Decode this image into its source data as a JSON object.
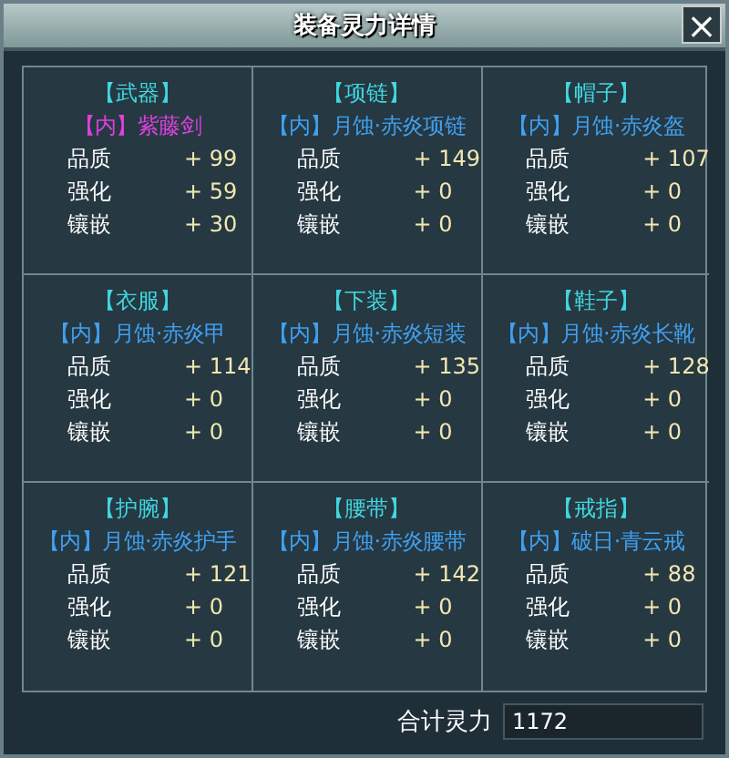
{
  "window": {
    "title": "装备灵力详情",
    "close": "×"
  },
  "slots": [
    {
      "slot": "【武器】",
      "item": "【内】紫藤剑",
      "color": "#e040e0",
      "stats": [
        {
          "label": "品质",
          "value": "+ 99"
        },
        {
          "label": "强化",
          "value": "+ 59"
        },
        {
          "label": "镶嵌",
          "value": "+ 30"
        }
      ]
    },
    {
      "slot": "【项链】",
      "item": "【内】月蚀·赤炎项链",
      "color": "#40a0f0",
      "stats": [
        {
          "label": "品质",
          "value": "+ 149"
        },
        {
          "label": "强化",
          "value": "+ 0"
        },
        {
          "label": "镶嵌",
          "value": "+ 0"
        }
      ]
    },
    {
      "slot": "【帽子】",
      "item": "【内】月蚀·赤炎盔",
      "color": "#40a0f0",
      "stats": [
        {
          "label": "品质",
          "value": "+ 107"
        },
        {
          "label": "强化",
          "value": "+ 0"
        },
        {
          "label": "镶嵌",
          "value": "+ 0"
        }
      ]
    },
    {
      "slot": "【衣服】",
      "item": "【内】月蚀·赤炎甲",
      "color": "#40a0f0",
      "stats": [
        {
          "label": "品质",
          "value": "+ 114"
        },
        {
          "label": "强化",
          "value": "+ 0"
        },
        {
          "label": "镶嵌",
          "value": "+ 0"
        }
      ]
    },
    {
      "slot": "【下装】",
      "item": "【内】月蚀·赤炎短装",
      "color": "#40a0f0",
      "stats": [
        {
          "label": "品质",
          "value": "+ 135"
        },
        {
          "label": "强化",
          "value": "+ 0"
        },
        {
          "label": "镶嵌",
          "value": "+ 0"
        }
      ]
    },
    {
      "slot": "【鞋子】",
      "item": "【内】月蚀·赤炎长靴",
      "color": "#40a0f0",
      "stats": [
        {
          "label": "品质",
          "value": "+ 128"
        },
        {
          "label": "强化",
          "value": "+ 0"
        },
        {
          "label": "镶嵌",
          "value": "+ 0"
        }
      ]
    },
    {
      "slot": "【护腕】",
      "item": "【内】月蚀·赤炎护手",
      "color": "#40a0f0",
      "stats": [
        {
          "label": "品质",
          "value": "+ 121"
        },
        {
          "label": "强化",
          "value": "+ 0"
        },
        {
          "label": "镶嵌",
          "value": "+ 0"
        }
      ]
    },
    {
      "slot": "【腰带】",
      "item": "【内】月蚀·赤炎腰带",
      "color": "#40a0f0",
      "stats": [
        {
          "label": "品质",
          "value": "+ 142"
        },
        {
          "label": "强化",
          "value": "+ 0"
        },
        {
          "label": "镶嵌",
          "value": "+ 0"
        }
      ]
    },
    {
      "slot": "【戒指】",
      "item": "【内】破日·青云戒",
      "color": "#40a0f0",
      "stats": [
        {
          "label": "品质",
          "value": "+ 88"
        },
        {
          "label": "强化",
          "value": "+ 0"
        },
        {
          "label": "镶嵌",
          "value": "+ 0"
        }
      ]
    }
  ],
  "total": {
    "label": "合计灵力",
    "value": "1172"
  }
}
